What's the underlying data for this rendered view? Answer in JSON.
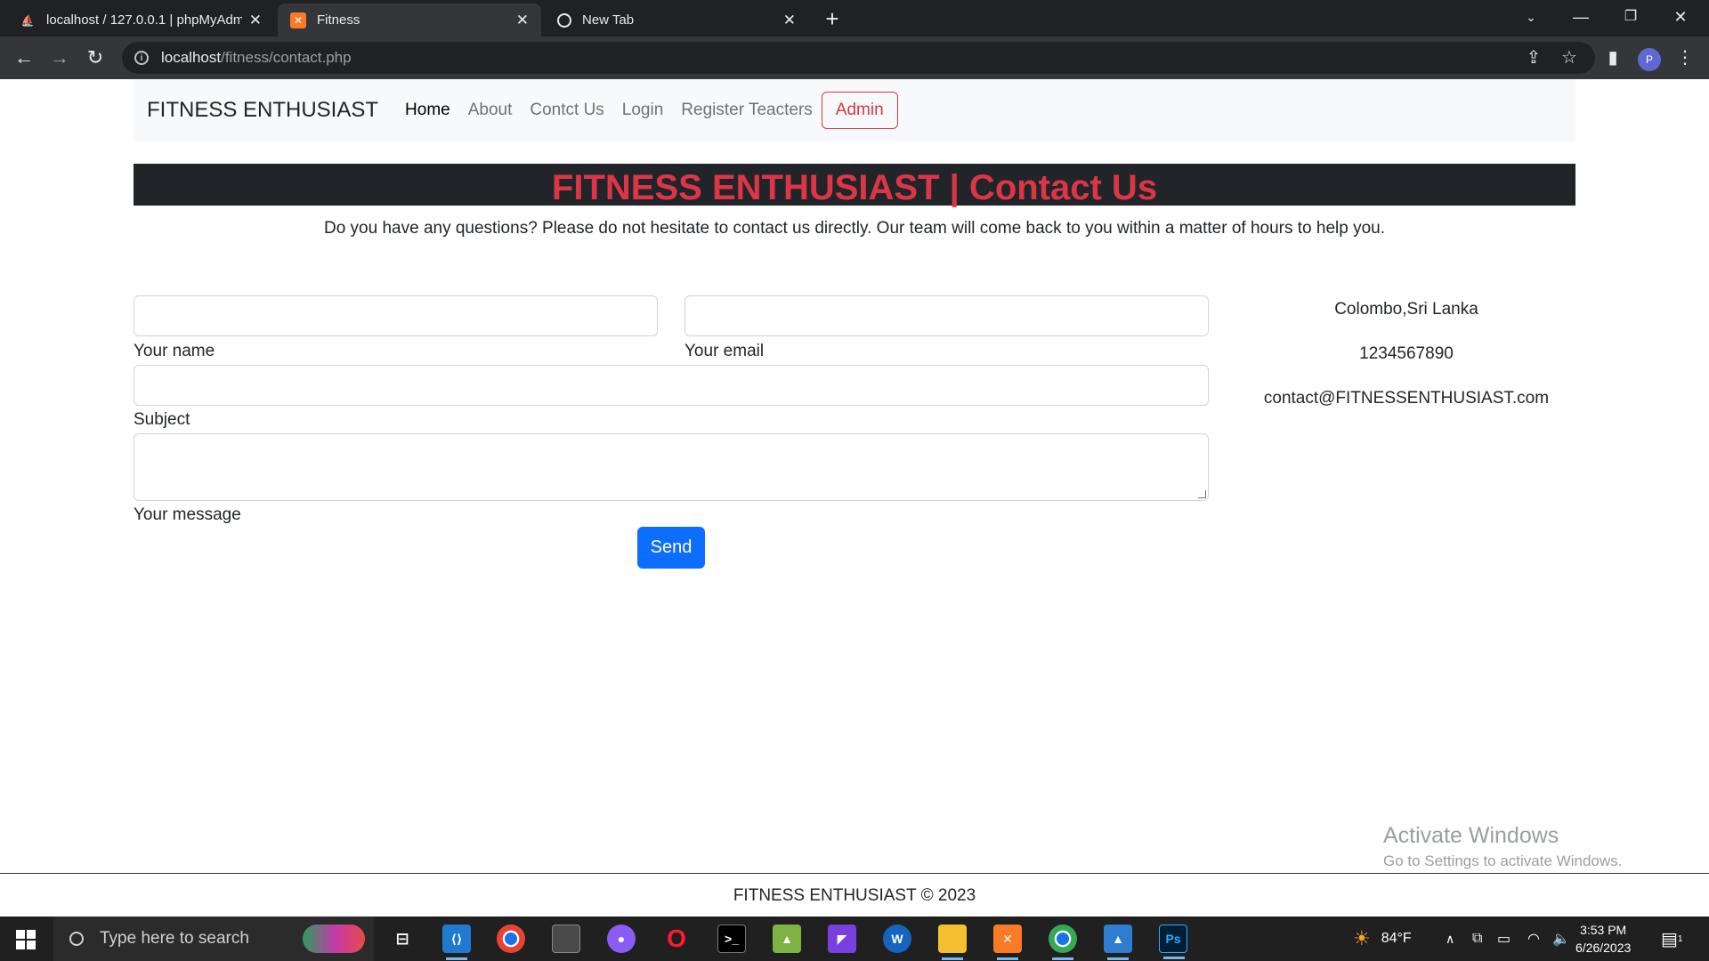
{
  "browser": {
    "tabs": [
      {
        "title": "localhost / 127.0.0.1 | phpMyAdm",
        "active": false
      },
      {
        "title": "Fitness",
        "active": true
      },
      {
        "title": "New Tab",
        "active": false
      }
    ],
    "url_host": "localhost",
    "url_path": "/fitness/contact.php",
    "profile_initial": "P"
  },
  "navbar": {
    "brand": "FITNESS ENTHUSIAST",
    "links": [
      "Home",
      "About",
      "Contct Us",
      "Login",
      "Register Teacters"
    ],
    "admin": "Admin"
  },
  "banner": {
    "title": "FITNESS ENTHUSIAST | Contact Us"
  },
  "intro": "Do you have any questions? Please do not hesitate to contact us directly. Our team will come back to you within a matter of hours to help you.",
  "form": {
    "name_label": "Your name",
    "email_label": "Your email",
    "subject_label": "Subject",
    "message_label": "Your message",
    "send": "Send"
  },
  "contact": {
    "address": "Colombo,Sri Lanka",
    "phone": "1234567890",
    "email": "contact@FITNESSENTHUSIAST.com"
  },
  "watermark": {
    "line1": "Activate Windows",
    "line2": "Go to Settings to activate Windows."
  },
  "footer": "FITNESS ENTHUSIAST © 2023",
  "taskbar": {
    "search_placeholder": "Type here to search",
    "weather": "84°F",
    "time": "3:53 PM",
    "date": "6/26/2023",
    "notification_count": "1"
  },
  "colors": {
    "danger": "#dc3545",
    "primary": "#0d6efd",
    "dark": "#212529"
  }
}
